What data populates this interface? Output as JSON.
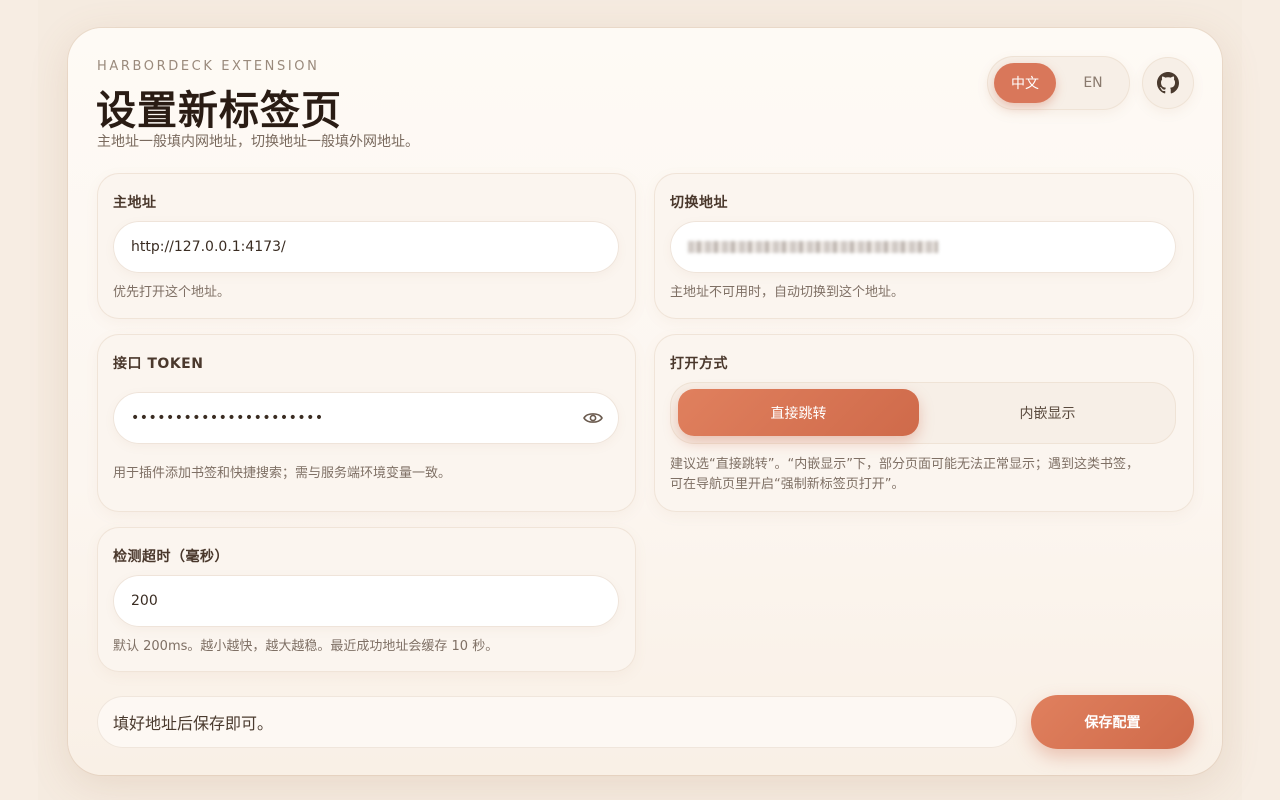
{
  "header": {
    "eyebrow": "HARBORDECK EXTENSION",
    "title": "设置新标签页",
    "subtitle": "主地址一般填内网地址，切换地址一般填外网地址。"
  },
  "language": {
    "options": [
      "中文",
      "EN"
    ],
    "selected": "中文"
  },
  "github_icon": "github-icon",
  "primary_url": {
    "label": "主地址",
    "value": "http://127.0.0.1:4173/",
    "hint": "优先打开这个地址。"
  },
  "fallback_url": {
    "label": "切换地址",
    "value": "",
    "hint": "主地址不可用时，自动切换到这个地址。"
  },
  "api_token": {
    "label": "接口 TOKEN",
    "value": "••••••••••••••••••••••",
    "hint": "用于插件添加书签和快捷搜索；需与服务端环境变量一致。",
    "toggle_icon": "eye-icon"
  },
  "open_mode": {
    "label": "打开方式",
    "options": [
      "直接跳转",
      "内嵌显示"
    ],
    "selected": "直接跳转",
    "hint_line1": "建议选“直接跳转”。“内嵌显示”下，部分页面可能无法正常显示；遇到这类书签，",
    "hint_line2": "可在导航页里开启“强制新标签页打开”。"
  },
  "timeout": {
    "label": "检测超时（毫秒）",
    "value": "200",
    "hint": "默认 200ms。越小越快，越大越稳。最近成功地址会缓存 10 秒。"
  },
  "footer": {
    "status": "填好地址后保存即可。",
    "save_label": "保存配置"
  },
  "colors": {
    "accent": "#d9775a",
    "background": "#f5ebe0",
    "panel": "#fefaf5"
  }
}
